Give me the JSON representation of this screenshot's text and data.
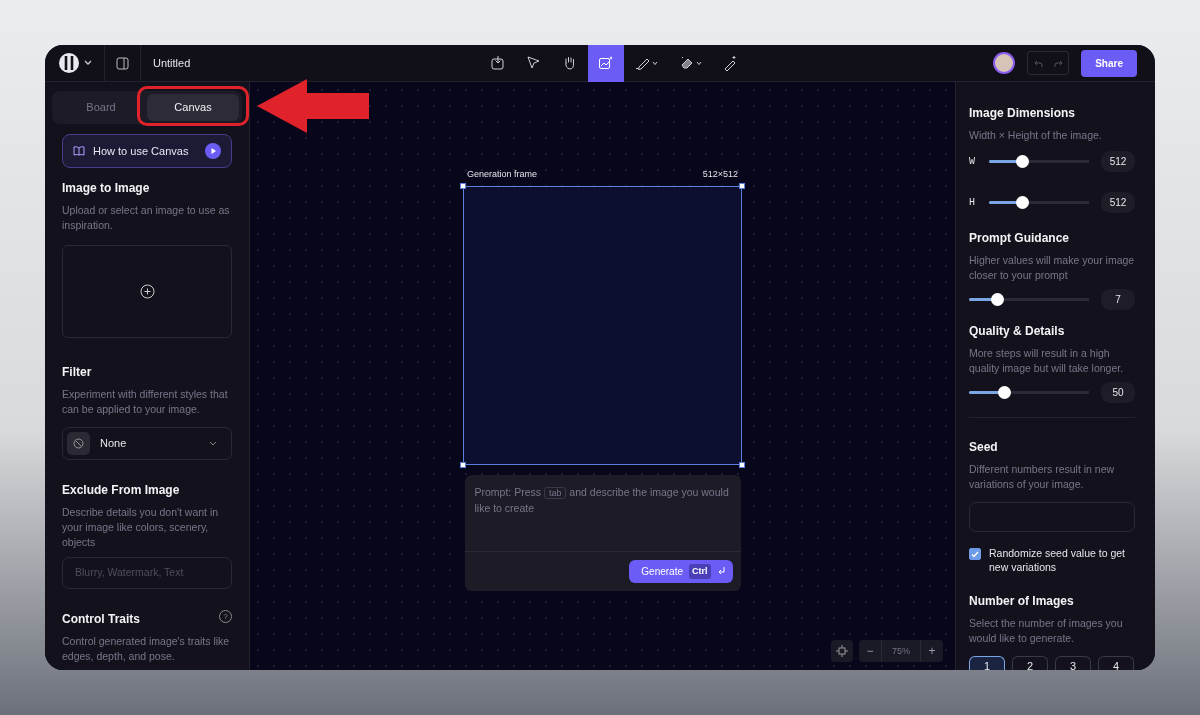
{
  "header": {
    "title": "Untitled",
    "tools": [
      {
        "kind": "import",
        "selected": false,
        "menu": false
      },
      {
        "kind": "select",
        "selected": false,
        "menu": false
      },
      {
        "kind": "hand",
        "selected": false,
        "menu": false
      },
      {
        "kind": "generate",
        "selected": true,
        "menu": false
      },
      {
        "kind": "pen",
        "selected": false,
        "menu": true
      },
      {
        "kind": "eraser",
        "selected": false,
        "menu": true
      },
      {
        "kind": "wand",
        "selected": false,
        "menu": false
      }
    ],
    "share": "Share"
  },
  "left_panel": {
    "mode_tabs": [
      {
        "label": "Board",
        "selected": false
      },
      {
        "label": "Canvas",
        "selected": true
      }
    ],
    "tutorial": "How to use Canvas",
    "image_to_image": {
      "title": "Image to Image",
      "description": "Upload or select an image to use as inspiration."
    },
    "filter": {
      "title": "Filter",
      "description": "Experiment with different styles that can be applied to your image.",
      "value": "None"
    },
    "exclude": {
      "title": "Exclude From Image",
      "description": "Describe details you don't want in your image like colors, scenery, objects",
      "placeholder": "Blurry, Watermark, Text"
    },
    "control_traits": {
      "title": "Control Traits",
      "help": "?",
      "description": "Control generated image's traits like edges, depth, and pose."
    }
  },
  "canvas": {
    "frame_label": "Generation frame",
    "frame_size": "512×512",
    "prompt": {
      "before": "Prompt: Press",
      "key": "tab",
      "after": "and describe the image you would like to create"
    },
    "generate": {
      "label": "Generate",
      "shortcut": "Ctrl"
    },
    "zoom": "75%",
    "zoom_out": "−",
    "zoom_in": "+"
  },
  "right_panel": {
    "dimensions": {
      "title": "Image Dimensions",
      "description": "Width × Height of the image.",
      "sliders": [
        {
          "label": "W",
          "level": 0.33,
          "reading": "512"
        },
        {
          "label": "H",
          "level": 0.33,
          "reading": "512"
        }
      ]
    },
    "guidance": {
      "title": "Prompt Guidance",
      "description": "Higher values will make your image closer to your prompt",
      "level": 0.23,
      "reading": "7"
    },
    "quality": {
      "title": "Quality & Details",
      "description": "More steps will result in a high quality image but will take longer.",
      "level": 0.29,
      "reading": "50"
    },
    "seed": {
      "title": "Seed",
      "description": "Different numbers result in new variations of your image.",
      "randomize": {
        "label": "Randomize seed value to get new variations",
        "checked": true
      }
    },
    "count": {
      "title": "Number of Images",
      "description": "Select the number of images you would like to generate.",
      "options": [
        {
          "label": "1",
          "selected": true
        },
        {
          "label": "2",
          "selected": false
        },
        {
          "label": "3",
          "selected": false
        },
        {
          "label": "4",
          "selected": false
        }
      ]
    }
  },
  "annotation": {
    "kind": "arrow-highlight"
  }
}
